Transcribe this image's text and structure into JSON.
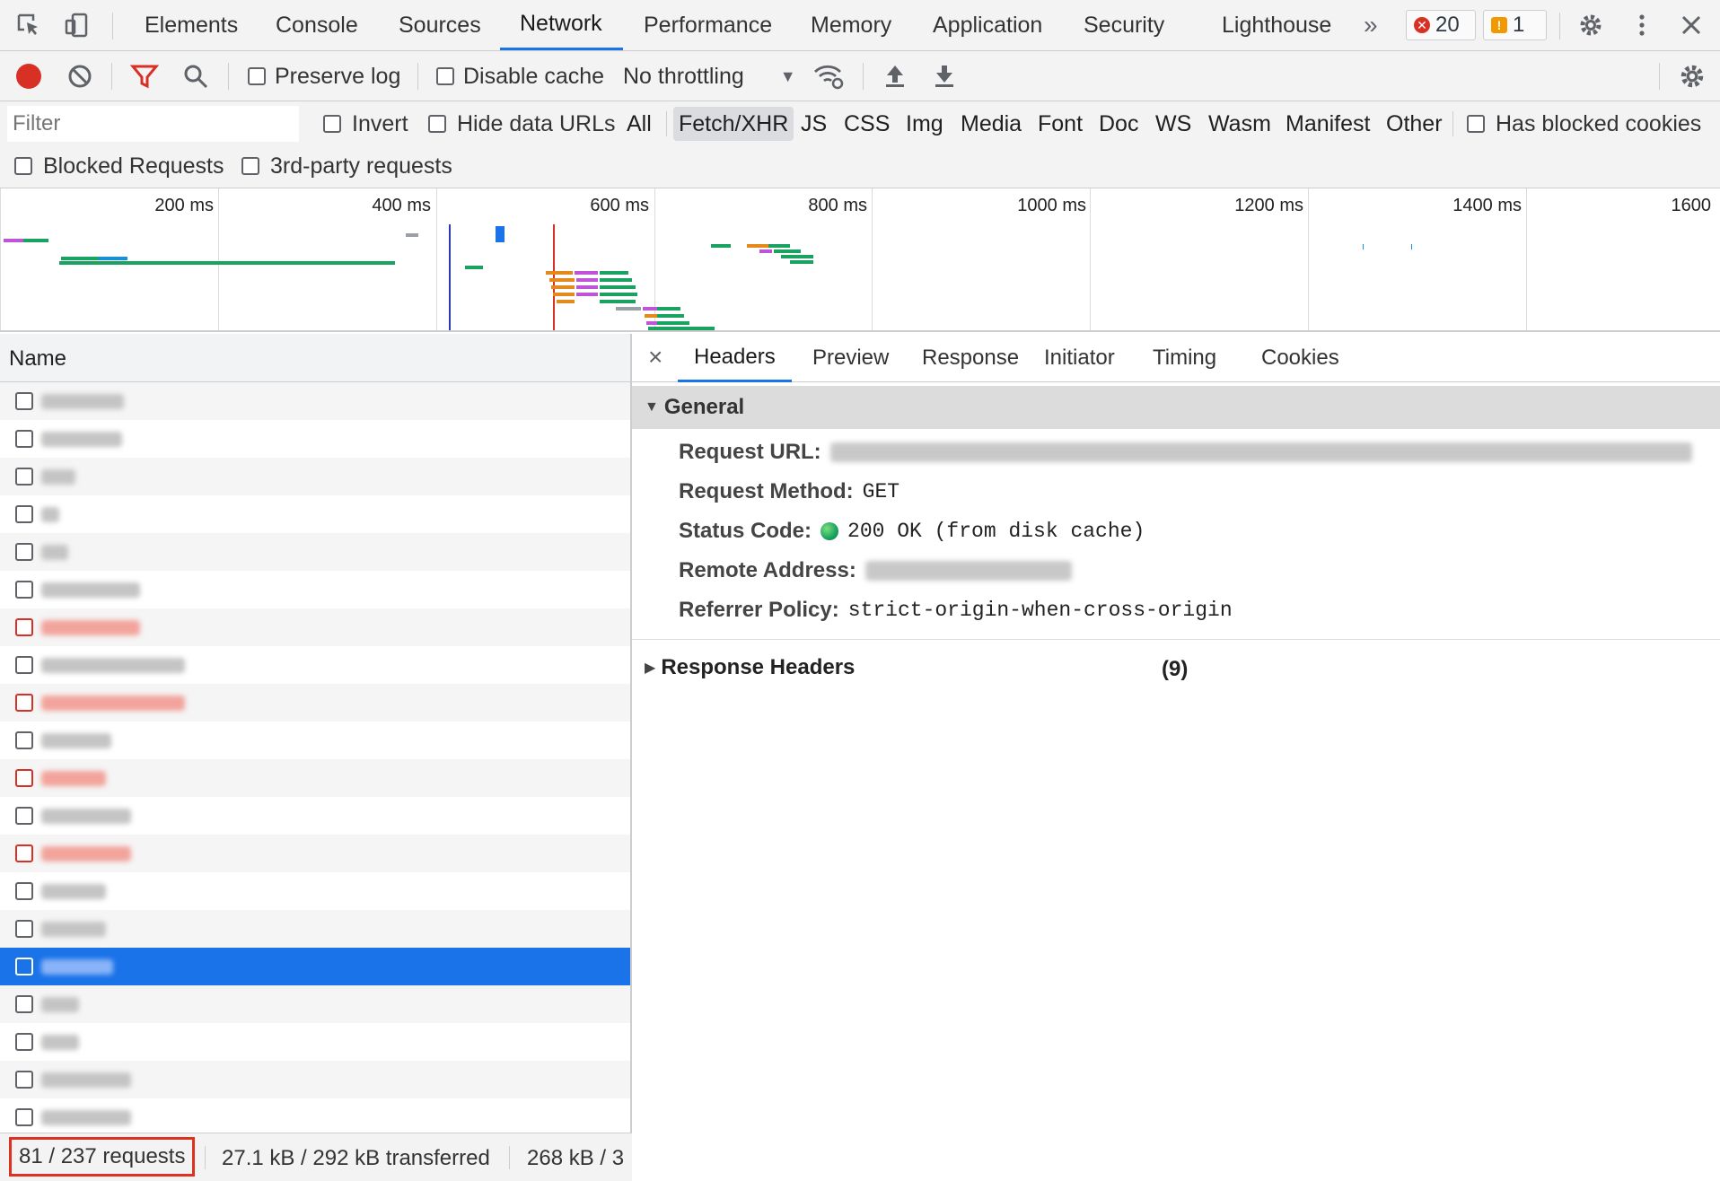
{
  "toolbar": {
    "tabs": [
      "Elements",
      "Console",
      "Sources",
      "Network",
      "Performance",
      "Memory",
      "Application",
      "Security",
      "Lighthouse"
    ],
    "active_tab": "Network",
    "more_tabs": "»",
    "error_count": "20",
    "warning_count": "1"
  },
  "network_toolbar": {
    "preserve_log": "Preserve log",
    "disable_cache": "Disable cache",
    "throttling": "No throttling"
  },
  "filter": {
    "placeholder": "Filter",
    "invert": "Invert",
    "hide_data_urls": "Hide data URLs",
    "types": [
      "All",
      "Fetch/XHR",
      "JS",
      "CSS",
      "Img",
      "Media",
      "Font",
      "Doc",
      "WS",
      "Wasm",
      "Manifest",
      "Other"
    ],
    "active_type": "Fetch/XHR",
    "has_blocked_cookies": "Has blocked cookies",
    "blocked_requests": "Blocked Requests",
    "third_party": "3rd-party requests"
  },
  "overview": {
    "labels": [
      "200 ms",
      "400 ms",
      "600 ms",
      "800 ms",
      "1000 ms",
      "1200 ms",
      "1400 ms",
      "1600"
    ]
  },
  "requests": {
    "column_name": "Name",
    "selected_row": 15,
    "error_rows": [
      6,
      8,
      10,
      12
    ]
  },
  "status": {
    "requests": "81 / 237 requests",
    "transferred": "27.1 kB / 292 kB transferred",
    "resources": "268 kB / 3"
  },
  "details": {
    "close": "×",
    "tabs": [
      "Headers",
      "Preview",
      "Response",
      "Initiator",
      "Timing",
      "Cookies"
    ],
    "active_tab": "Headers",
    "general_title": "General",
    "request_url_label": "Request URL:",
    "request_method_label": "Request Method:",
    "request_method": "GET",
    "status_code_label": "Status Code:",
    "status_code": "200 OK (from disk cache)",
    "remote_address_label": "Remote Address:",
    "referrer_policy_label": "Referrer Policy:",
    "referrer_policy": "strict-origin-when-cross-origin",
    "response_headers_title": "Response Headers",
    "response_headers_count": "(9)"
  },
  "colors": {
    "accent": "#1a73e8",
    "record": "#d93025",
    "status_ok": "#1aa260"
  }
}
